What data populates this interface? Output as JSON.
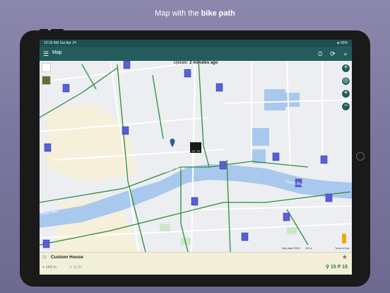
{
  "headline": {
    "prefix": "Map with the ",
    "bold": "bike path"
  },
  "status": {
    "time": "10:35 AM",
    "date": "Sat Apr 24",
    "right": "◈ 65%"
  },
  "appbar": {
    "title": "Map",
    "menu_icon": "hamburger-icon",
    "action_icons": [
      "timer-icon",
      "refresh-icon",
      "search-icon"
    ]
  },
  "update": {
    "prefix": "Update: ",
    "value": "2 minutes ago"
  },
  "river_label_1": "River Liffey",
  "river_label_2": "River Liffey",
  "river_label_3": "River Liffey",
  "map_credit": "Map data ©2021",
  "map_scale": "100 m",
  "terms": "Terms of Use",
  "selected_marker": {
    "bikes": "15",
    "docks": "15"
  },
  "station": {
    "number": "23",
    "name": "Custom House",
    "distance": "140 m",
    "updated": "10:35",
    "bikes": "15",
    "docks": "15"
  },
  "colors": {
    "teal": "#245c5c",
    "path": "#2e8b3a",
    "marker": "#5a5fd6",
    "river": "#a9c8ee"
  }
}
